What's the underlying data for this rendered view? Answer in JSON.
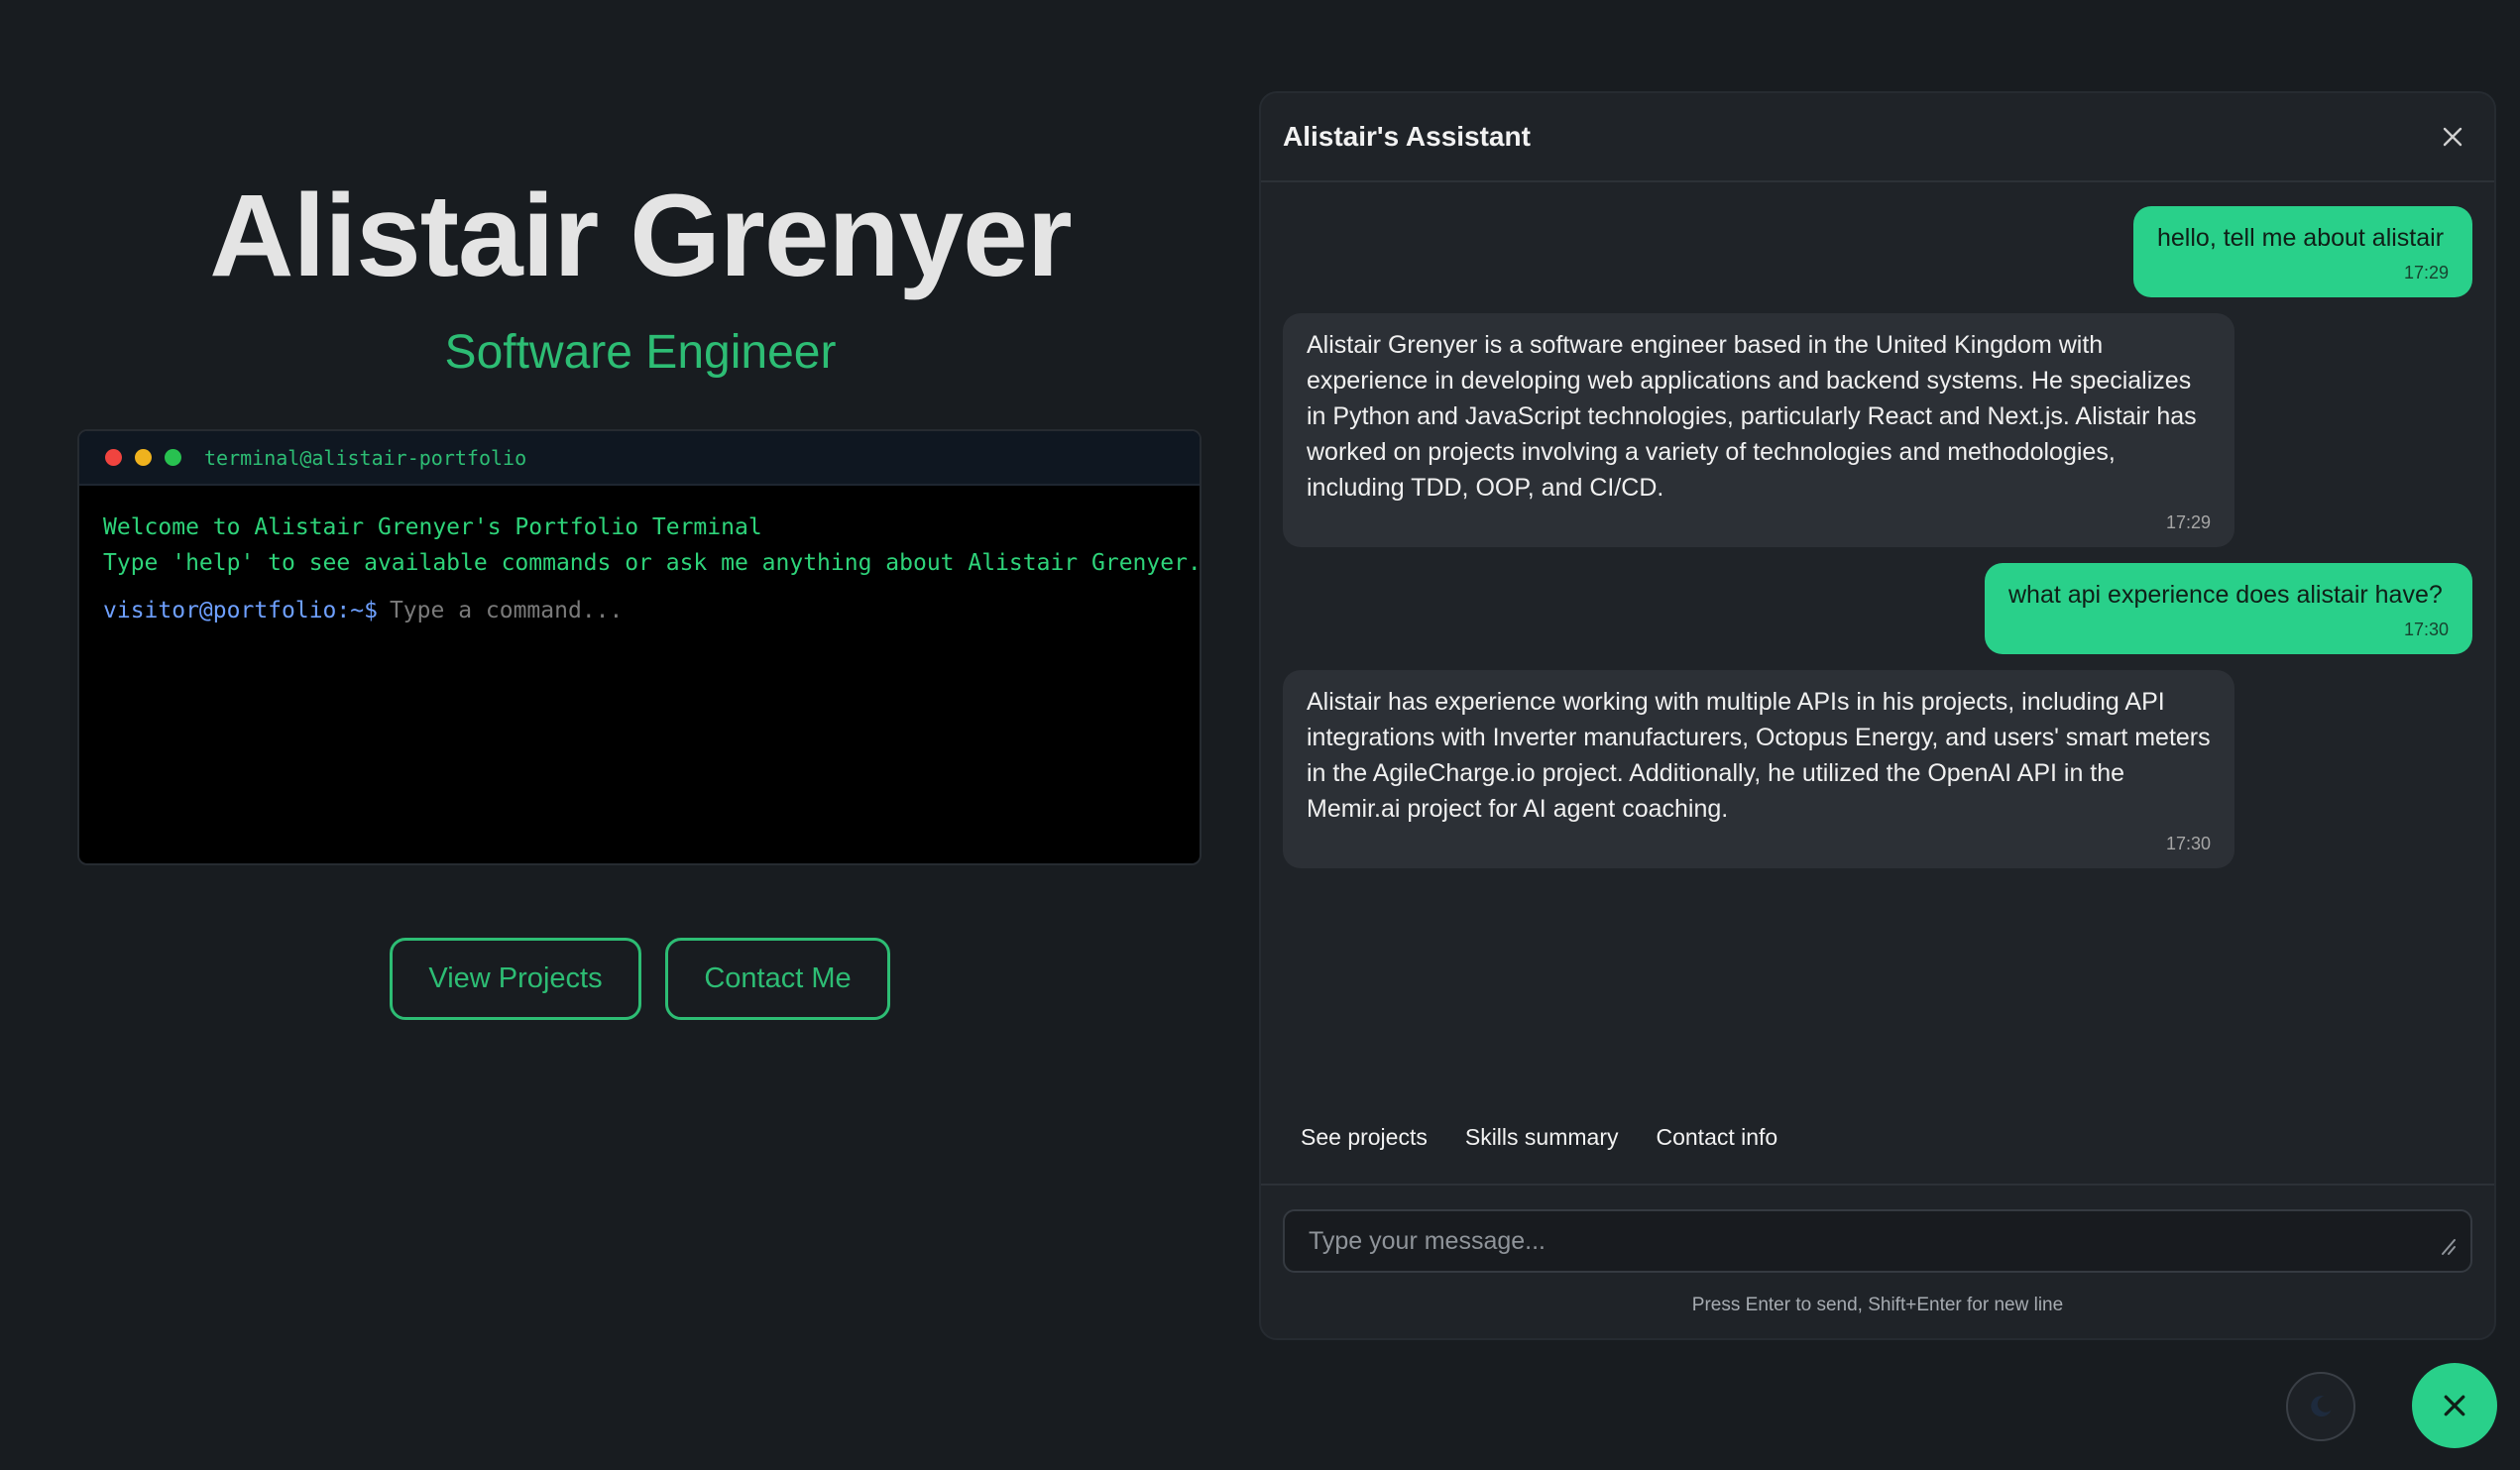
{
  "hero": {
    "name": "Alistair Grenyer",
    "role": "Software Engineer"
  },
  "terminal": {
    "title": "terminal@alistair-portfolio",
    "welcome": "Welcome to Alistair Grenyer's Portfolio Terminal",
    "help": "Type 'help' to see available commands or ask me anything about Alistair Grenyer...",
    "prompt": "visitor@portfolio:~$",
    "placeholder": "Type a command..."
  },
  "buttons": {
    "projects": "View Projects",
    "contact": "Contact Me"
  },
  "chat": {
    "title": "Alistair's Assistant",
    "messages": [
      {
        "role": "user",
        "text": "hello, tell me about alistair",
        "time": "17:29"
      },
      {
        "role": "assistant",
        "text": "Alistair Grenyer is a software engineer based in the United Kingdom with experience in developing web applications and backend systems. He specializes in Python and JavaScript technologies, particularly React and Next.js. Alistair has worked on projects involving a variety of technologies and methodologies, including TDD, OOP, and CI/CD.",
        "time": "17:29"
      },
      {
        "role": "user",
        "text": "what api experience does alistair have?",
        "time": "17:30"
      },
      {
        "role": "assistant",
        "text": "Alistair has experience working with multiple APIs in his projects, including API integrations with Inverter manufacturers, Octopus Energy, and users' smart meters in the AgileCharge.io project. Additionally, he utilized the OpenAI API in the Memir.ai project for AI agent coaching.",
        "time": "17:30"
      }
    ],
    "quick_replies": [
      "See projects",
      "Skills summary",
      "Contact info"
    ],
    "input_placeholder": "Type your message...",
    "hint": "Press Enter to send, Shift+Enter for new line"
  },
  "icons": {
    "chat_close": "close-icon",
    "resize": "resize-handle-icon",
    "theme": "moon-icon",
    "fab": "close-icon"
  },
  "colors": {
    "accent": "#2dbd74",
    "user_bubble": "#29d08a",
    "bot_bubble": "#2c3036",
    "background": "#181c20"
  }
}
